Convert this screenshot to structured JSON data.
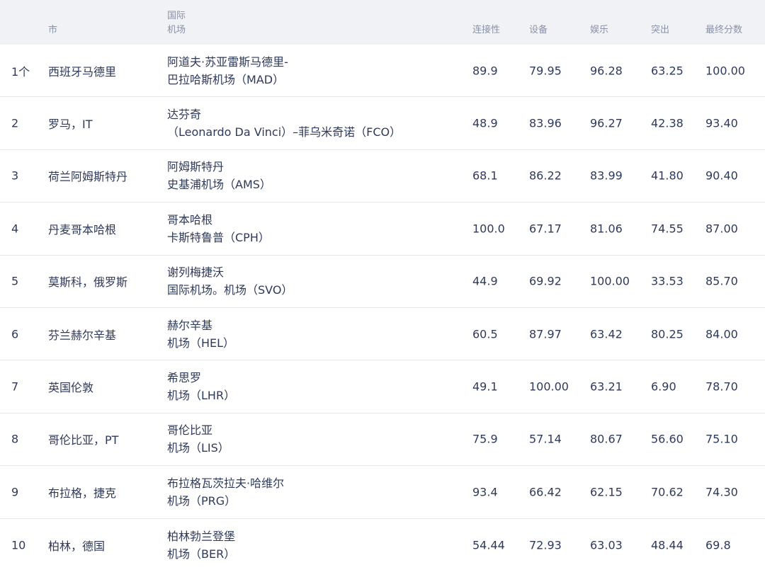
{
  "headers": {
    "rank": "",
    "city": "市",
    "airport_line1": "国际",
    "airport_line2": "机场",
    "connectivity": "连接性",
    "facilities": "设备",
    "entertainment": "娱乐",
    "outstanding": "突出",
    "final_score": "最终分数"
  },
  "rows": [
    {
      "rank": "1个",
      "city": "西班牙马德里",
      "airport_line1": "阿道夫·苏亚雷斯马德里-",
      "airport_line2": "巴拉哈斯机场（MAD）",
      "connectivity": "89.9",
      "facilities": "79.95",
      "entertainment": "96.28",
      "outstanding": "63.25",
      "final_score": "100.00"
    },
    {
      "rank": "2",
      "city": "罗马，IT",
      "airport_line1": "达芬奇",
      "airport_line2": "（Leonardo Da Vinci）–菲乌米奇诺（FCO）",
      "connectivity": "48.9",
      "facilities": "83.96",
      "entertainment": "96.27",
      "outstanding": "42.38",
      "final_score": "93.40"
    },
    {
      "rank": "3",
      "city": "荷兰阿姆斯特丹",
      "airport_line1": "阿姆斯特丹",
      "airport_line2": "史基浦机场（AMS）",
      "connectivity": "68.1",
      "facilities": "86.22",
      "entertainment": "83.99",
      "outstanding": "41.80",
      "final_score": "90.40"
    },
    {
      "rank": "4",
      "city": "丹麦哥本哈根",
      "airport_line1": "哥本哈根",
      "airport_line2": "卡斯特鲁普（CPH）",
      "connectivity": "100.0",
      "facilities": "67.17",
      "entertainment": "81.06",
      "outstanding": "74.55",
      "final_score": "87.00"
    },
    {
      "rank": "5",
      "city": "莫斯科，俄罗斯",
      "airport_line1": "谢列梅捷沃",
      "airport_line2": "国际机场。机场（SVO）",
      "connectivity": "44.9",
      "facilities": "69.92",
      "entertainment": "100.00",
      "outstanding": "33.53",
      "final_score": "85.70"
    },
    {
      "rank": "6",
      "city": "芬兰赫尔辛基",
      "airport_line1": "赫尔辛基",
      "airport_line2": "机场（HEL）",
      "connectivity": "60.5",
      "facilities": "87.97",
      "entertainment": "63.42",
      "outstanding": "80.25",
      "final_score": "84.00"
    },
    {
      "rank": "7",
      "city": "英国伦敦",
      "airport_line1": "希思罗",
      "airport_line2": "机场（LHR）",
      "connectivity": "49.1",
      "facilities": "100.00",
      "entertainment": "63.21",
      "outstanding": "6.90",
      "final_score": "78.70"
    },
    {
      "rank": "8",
      "city": "哥伦比亚，PT",
      "airport_line1": "哥伦比亚",
      "airport_line2": "机场（LIS）",
      "connectivity": "75.9",
      "facilities": "57.14",
      "entertainment": "80.67",
      "outstanding": "56.60",
      "final_score": "75.10"
    },
    {
      "rank": "9",
      "city": "布拉格，捷克",
      "airport_line1": "布拉格瓦茨拉夫·哈维尔",
      "airport_line2": "机场（PRG）",
      "connectivity": "93.4",
      "facilities": "66.42",
      "entertainment": "62.15",
      "outstanding": "70.62",
      "final_score": "74.30"
    },
    {
      "rank": "10",
      "city": "柏林，德国",
      "airport_line1": "柏林勃兰登堡",
      "airport_line2": "机场（BER）",
      "connectivity": "54.44",
      "facilities": "72.93",
      "entertainment": "63.03",
      "outstanding": "48.44",
      "final_score": "69.8"
    }
  ]
}
